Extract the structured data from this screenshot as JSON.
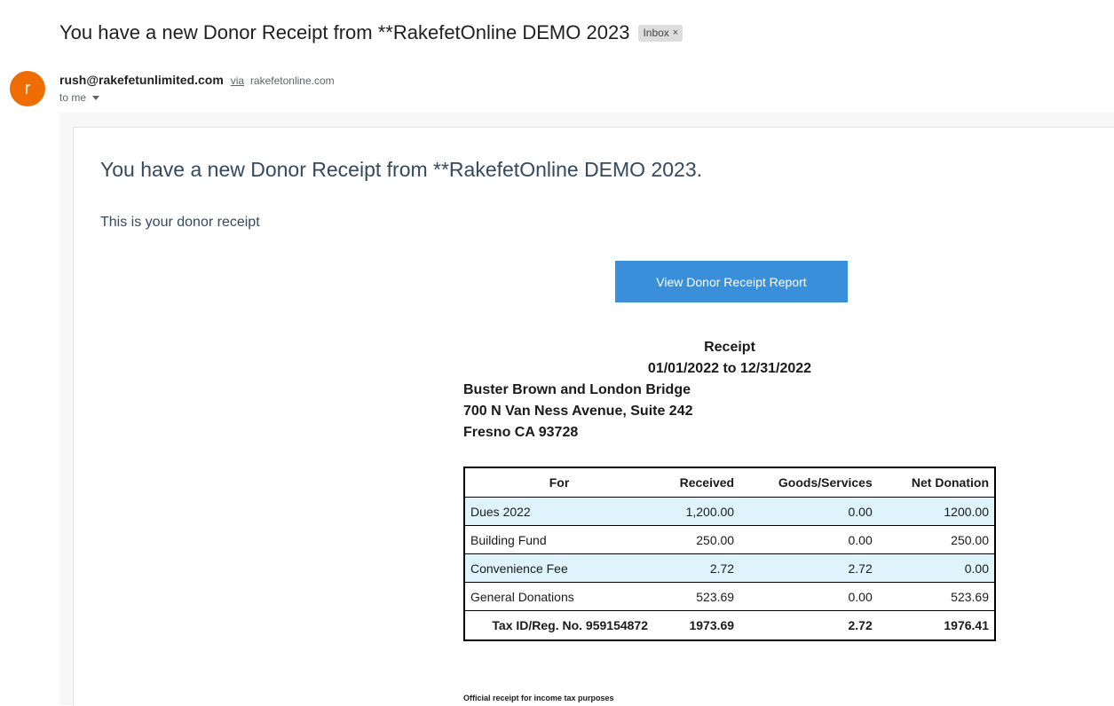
{
  "email": {
    "subject": "You have a new Donor Receipt from **RakefetOnline DEMO 2023",
    "label_chip": "Inbox",
    "label_chip_close": "×",
    "avatar_letter": "r",
    "sender_email": "rush@rakefetunlimited.com",
    "via_text": "via",
    "via_domain": "rakefetonline.com",
    "to_text": "to me"
  },
  "body": {
    "title": "You have a new Donor Receipt from **RakefetOnline DEMO 2023.",
    "intro": "This is your donor receipt",
    "button_label": "View Donor Receipt Report"
  },
  "receipt": {
    "heading": "Receipt",
    "date_range": "01/01/2022 to 12/31/2022",
    "address": {
      "line1": "Buster Brown and London Bridge",
      "line2": "700 N Van Ness Avenue, Suite 242",
      "line3": "Fresno CA 93728"
    },
    "columns": [
      "For",
      "Received",
      "Goods/Services",
      "Net Donation"
    ],
    "rows": [
      {
        "for": "Dues 2022",
        "received": "1,200.00",
        "goods": "0.00",
        "net": "1200.00"
      },
      {
        "for": "Building Fund",
        "received": "250.00",
        "goods": "0.00",
        "net": "250.00"
      },
      {
        "for": "Convenience Fee",
        "received": "2.72",
        "goods": "2.72",
        "net": "0.00"
      },
      {
        "for": "General Donations",
        "received": "523.69",
        "goods": "0.00",
        "net": "523.69"
      }
    ],
    "total": {
      "label": "Tax ID/Reg. No. 959154872",
      "received": "1973.69",
      "goods": "2.72",
      "net": "1976.41"
    },
    "footer_note": "Official receipt for income tax purposes"
  },
  "colors": {
    "avatar": "#ef6c00",
    "button": "#3a8fdb",
    "row_shade": "#dff3fd",
    "heading_text": "#34495e"
  }
}
